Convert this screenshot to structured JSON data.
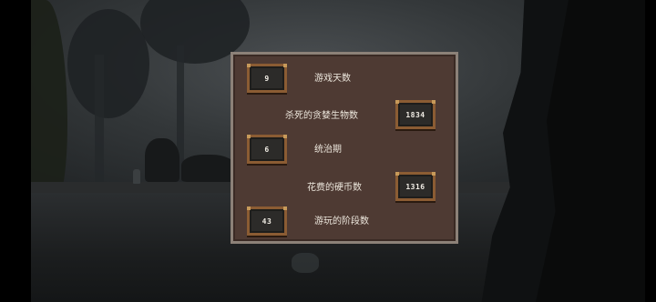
{
  "stats": [
    {
      "value": "9",
      "label": "游戏天数"
    },
    {
      "value": "1834",
      "label": "杀死的贪婪生物数"
    },
    {
      "value": "6",
      "label": "统治期"
    },
    {
      "value": "1316",
      "label": "花费的硬币数"
    },
    {
      "value": "43",
      "label": "游玩的阶段数"
    }
  ],
  "colors": {
    "panel_bg": "#4e3a33",
    "panel_border": "#8c8178",
    "box_bg": "#2c2b29",
    "box_border": "#8b5c33",
    "text": "#ece6dc"
  }
}
